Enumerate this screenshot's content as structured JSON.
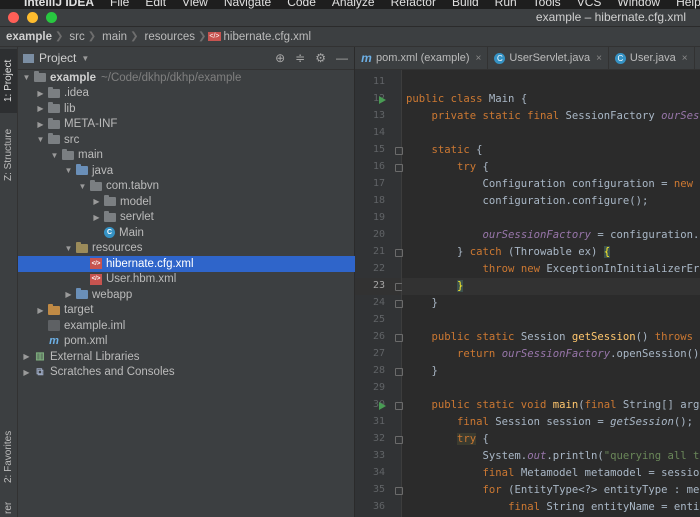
{
  "menubar": {
    "apple": "",
    "app": "IntelliJ IDEA",
    "items": [
      "File",
      "Edit",
      "View",
      "Navigate",
      "Code",
      "Analyze",
      "Refactor",
      "Build",
      "Run",
      "Tools",
      "VCS",
      "Window",
      "Help"
    ]
  },
  "window": {
    "title": "example – hibernate.cfg.xml"
  },
  "breadcrumb": [
    "example",
    "src",
    "main",
    "resources",
    "hibernate.cfg.xml"
  ],
  "side_tabs": {
    "project": "1: Project",
    "structure": "Z: Structure",
    "favorites": "2: Favorites",
    "explorer": "rer"
  },
  "project_panel": {
    "title": "Project",
    "tree": [
      {
        "label": "example",
        "hint": "~/Code/dkhp/dkhp/example",
        "depth": 0,
        "arrow": "down",
        "icon": "module",
        "bold": true
      },
      {
        "label": ".idea",
        "depth": 1,
        "arrow": "right",
        "icon": "folder"
      },
      {
        "label": "lib",
        "depth": 1,
        "arrow": "right",
        "icon": "folder"
      },
      {
        "label": "META-INF",
        "depth": 1,
        "arrow": "right",
        "icon": "folder"
      },
      {
        "label": "src",
        "depth": 1,
        "arrow": "down",
        "icon": "folder"
      },
      {
        "label": "main",
        "depth": 2,
        "arrow": "down",
        "icon": "folder"
      },
      {
        "label": "java",
        "depth": 3,
        "arrow": "down",
        "icon": "folder-src"
      },
      {
        "label": "com.tabvn",
        "depth": 4,
        "arrow": "down",
        "icon": "package"
      },
      {
        "label": "model",
        "depth": 5,
        "arrow": "right",
        "icon": "package"
      },
      {
        "label": "servlet",
        "depth": 5,
        "arrow": "right",
        "icon": "package"
      },
      {
        "label": "Main",
        "depth": 5,
        "arrow": "none",
        "icon": "class"
      },
      {
        "label": "resources",
        "depth": 3,
        "arrow": "down",
        "icon": "folder-res"
      },
      {
        "label": "hibernate.cfg.xml",
        "depth": 4,
        "arrow": "none",
        "icon": "xml",
        "selected": true
      },
      {
        "label": "User.hbm.xml",
        "depth": 4,
        "arrow": "none",
        "icon": "xml"
      },
      {
        "label": "webapp",
        "depth": 3,
        "arrow": "right",
        "icon": "folder-web"
      },
      {
        "label": "target",
        "depth": 1,
        "arrow": "right",
        "icon": "folder-target"
      },
      {
        "label": "example.iml",
        "depth": 1,
        "arrow": "none",
        "icon": "iml"
      },
      {
        "label": "pom.xml",
        "depth": 1,
        "arrow": "none",
        "icon": "maven"
      },
      {
        "label": "External Libraries",
        "depth": 0,
        "arrow": "right",
        "icon": "libs"
      },
      {
        "label": "Scratches and Consoles",
        "depth": 0,
        "arrow": "right",
        "icon": "scratch"
      }
    ]
  },
  "editor_tabs": [
    {
      "label": "pom.xml (example)",
      "icon": "m"
    },
    {
      "label": "UserServlet.java",
      "icon": "c"
    },
    {
      "label": "User.java",
      "icon": "c"
    },
    {
      "label": "hibe",
      "icon": "xml"
    }
  ],
  "code_lines": [
    {
      "n": "11",
      "html": ""
    },
    {
      "n": "12",
      "html": "<span class=\"kw\">public class</span> Main {",
      "run": true
    },
    {
      "n": "13",
      "html": "    <span class=\"kw\">private static final</span> SessionFactory <span class=\"fld\">ourSessionF</span>"
    },
    {
      "n": "14",
      "html": ""
    },
    {
      "n": "15",
      "html": "    <span class=\"kw\">static</span> {",
      "fold": true
    },
    {
      "n": "16",
      "html": "        <span class=\"kw\">try</span> {",
      "fold": true
    },
    {
      "n": "17",
      "html": "            Configuration configuration = <span class=\"kw\">new</span> Con"
    },
    {
      "n": "18",
      "html": "            configuration.configure();"
    },
    {
      "n": "19",
      "html": ""
    },
    {
      "n": "20",
      "html": "            <span class=\"fld\">ourSessionFactory</span> = configuration.buil"
    },
    {
      "n": "21",
      "html": "        } <span class=\"kw\">catch</span> (Throwable ex) <span class=\"brace\">{</span>",
      "fold": true
    },
    {
      "n": "22",
      "html": "            <span class=\"kw\">throw new</span> ExceptionInInitializerError"
    },
    {
      "n": "23",
      "html": "        <span class=\"brace\">}</span>",
      "cur": true,
      "fold": true
    },
    {
      "n": "24",
      "html": "    }",
      "fold": true
    },
    {
      "n": "25",
      "html": ""
    },
    {
      "n": "26",
      "html": "    <span class=\"kw\">public static</span> Session <span class=\"fn\">getSession</span>() <span class=\"kw\">throws</span> Hib",
      "fold": true
    },
    {
      "n": "27",
      "html": "        <span class=\"kw\">return</span> <span class=\"fld\">ourSessionFactory</span>.openSession();"
    },
    {
      "n": "28",
      "html": "    }",
      "fold": true
    },
    {
      "n": "29",
      "html": ""
    },
    {
      "n": "30",
      "html": "    <span class=\"kw\">public static void</span> <span class=\"fn\">main</span>(<span class=\"kw\">final</span> String[] args)",
      "run": true,
      "fold": true
    },
    {
      "n": "31",
      "html": "        <span class=\"kw\">final</span> Session session = <span class=\"st\">getSession</span>();"
    },
    {
      "n": "32",
      "html": "        <span class=\"kw\" style=\"background:#3b3b2f\">try</span> {",
      "fold": true
    },
    {
      "n": "33",
      "html": "            System.<span class=\"fld\">out</span>.println(<span class=\"str\">\"querying all the</span>"
    },
    {
      "n": "34",
      "html": "            <span class=\"kw\">final</span> Metamodel metamodel = session.g"
    },
    {
      "n": "35",
      "html": "            <span class=\"kw\">for</span> (EntityType&lt;?&gt; entityType : metam",
      "fold": true
    },
    {
      "n": "36",
      "html": "                <span class=\"kw\">final</span> String entityName = entity"
    }
  ]
}
